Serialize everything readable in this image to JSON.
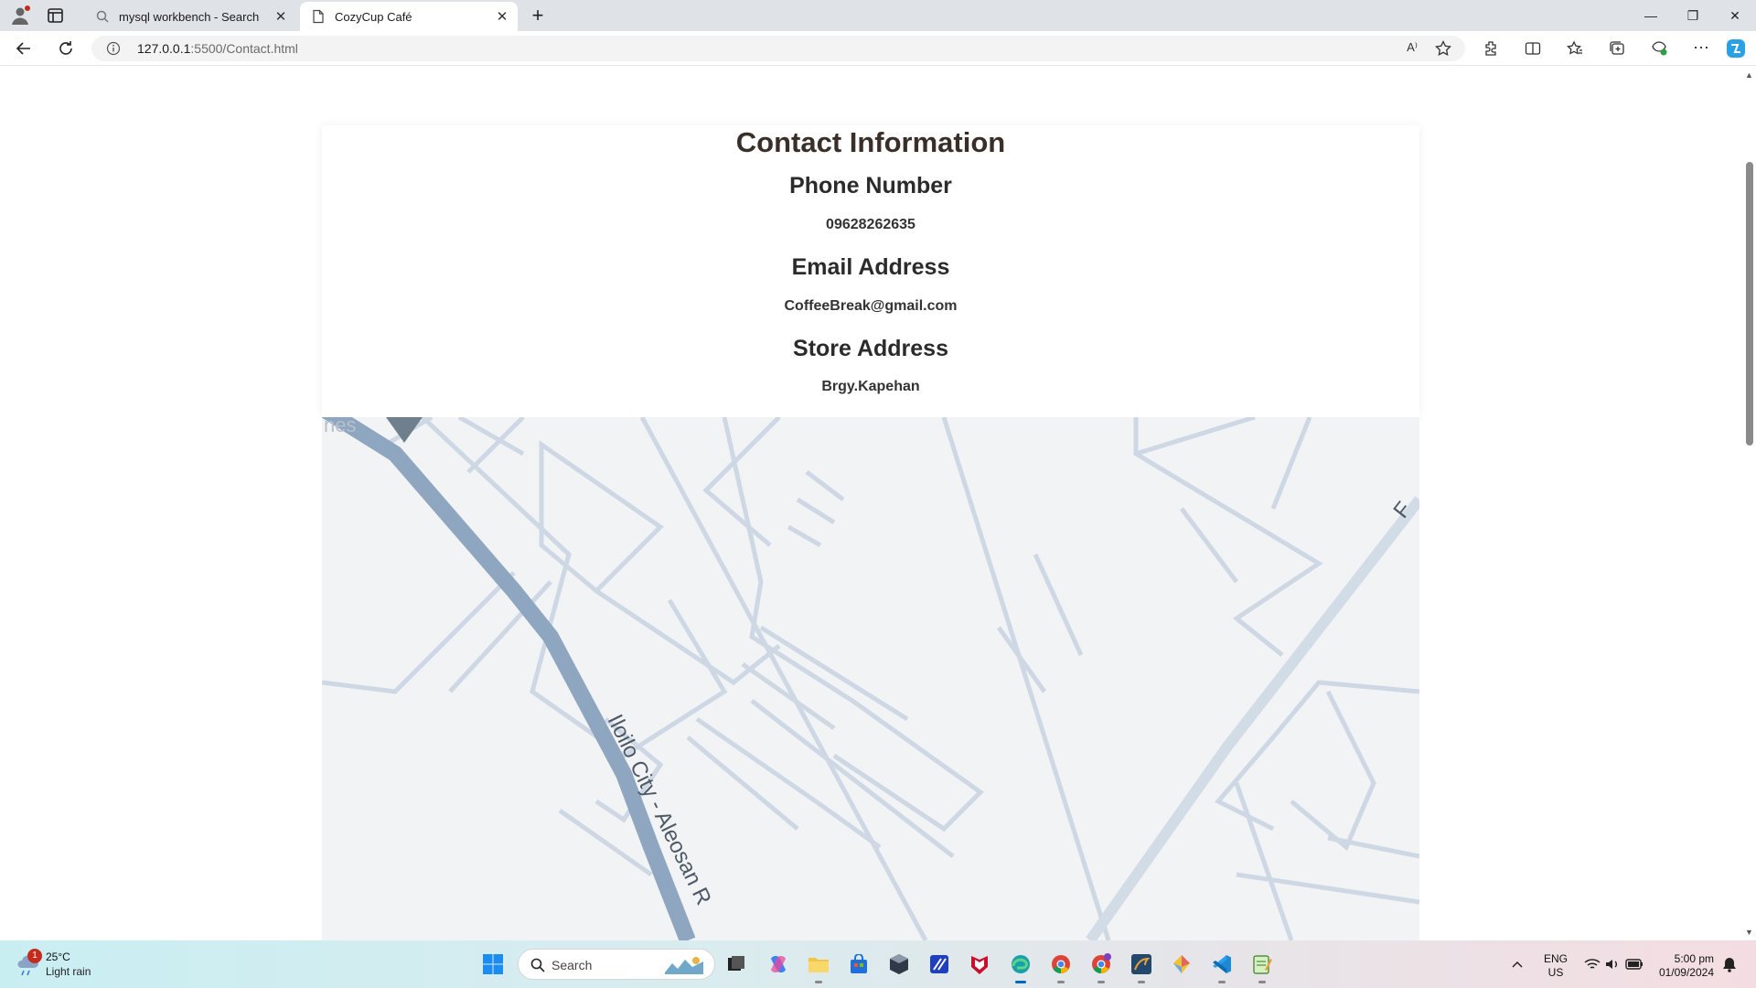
{
  "browser": {
    "tabs": [
      {
        "title": "mysql workbench - Search",
        "active": false,
        "favicon": "search-icon"
      },
      {
        "title": "CozyCup Café",
        "active": true,
        "favicon": "page-icon"
      }
    ],
    "new_tab_label": "+",
    "url_host": "127.0.0.1",
    "url_rest": ":5500/Contact.html",
    "read_aloud_label": "A⁾"
  },
  "page": {
    "heading": "Contact Information",
    "phone_heading": "Phone Number",
    "phone_value": "09628262635",
    "email_heading": "Email Address",
    "email_value": "CoffeeBreak@gmail.com",
    "address_heading": "Store Address",
    "address_value": "Brgy.Kapehan"
  },
  "map": {
    "road_label": "Iloilo City - Aleosan R",
    "corner_label_top_left": "nes",
    "corner_label_right": "F",
    "main_road_color": "#8fa6c0",
    "street_color": "#cdd8e4",
    "background_color": "#f2f3f5"
  },
  "taskbar": {
    "weather_temp": "25°C",
    "weather_condition": "Light rain",
    "weather_badge": "1",
    "search_placeholder": "Search",
    "lang_line1": "ENG",
    "lang_line2": "US",
    "time": "5:00 pm",
    "date": "01/09/2024"
  },
  "colors": {
    "accent": "#0067c0",
    "heading_text": "#3a2e28",
    "tabbar_bg": "#dfe3e8"
  }
}
